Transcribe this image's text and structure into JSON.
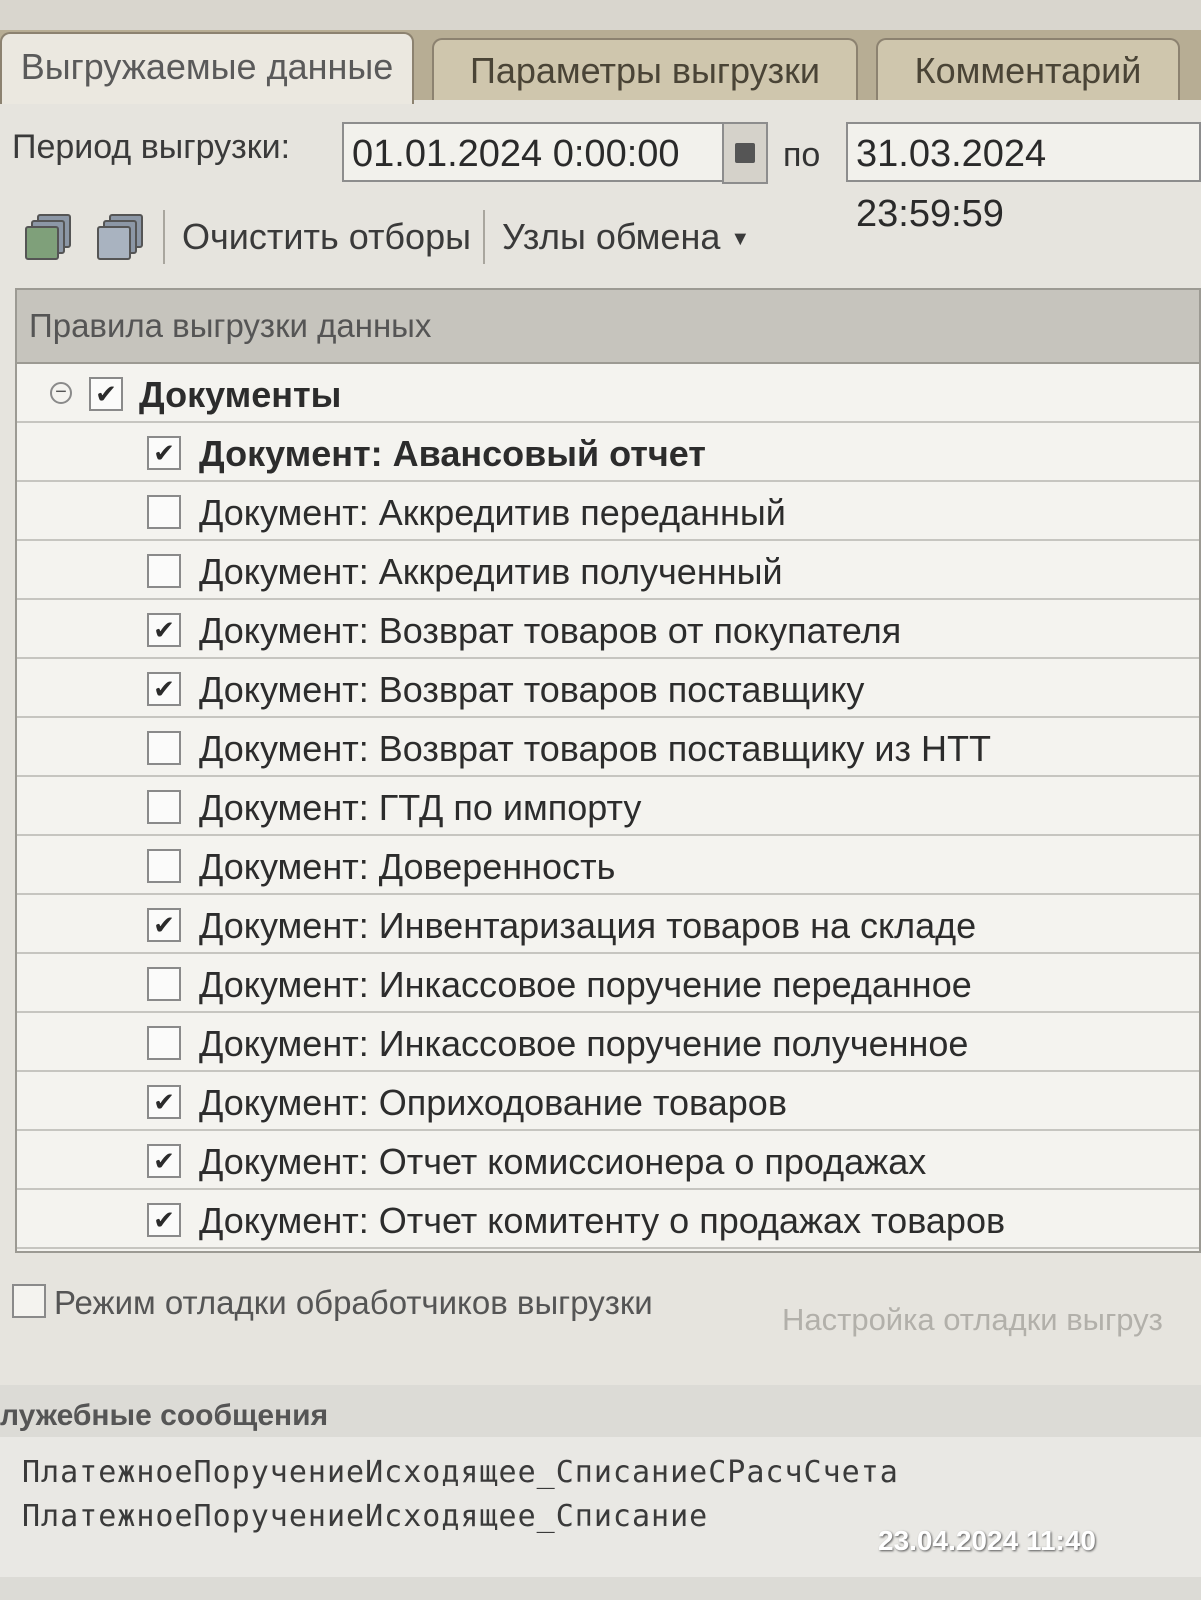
{
  "tabs": [
    {
      "label": "Выгружаемые данные",
      "active": true
    },
    {
      "label": "Параметры выгрузки",
      "active": false
    },
    {
      "label": "Комментарий",
      "active": false
    }
  ],
  "period": {
    "label": "Период выгрузки:",
    "from": "01.01.2024  0:00:00",
    "to_label": "по",
    "to": "31.03.2024 23:59:59"
  },
  "toolbar": {
    "select_all_icon": "check-all-icon",
    "unselect_all_icon": "uncheck-all-icon",
    "clear_filters": "Очистить отборы",
    "exchange_nodes": "Узлы обмена",
    "dropdown_caret": "▼"
  },
  "tree": {
    "header": "Правила выгрузки данных",
    "group": {
      "label": "Документы",
      "checked": true,
      "collapse_symbol": "−"
    },
    "items": [
      {
        "label": "Документ: Авансовый отчет",
        "checked": true,
        "bold": true
      },
      {
        "label": "Документ: Аккредитив переданный",
        "checked": false
      },
      {
        "label": "Документ: Аккредитив полученный",
        "checked": false
      },
      {
        "label": "Документ: Возврат товаров от покупателя",
        "checked": true
      },
      {
        "label": "Документ: Возврат товаров поставщику",
        "checked": true
      },
      {
        "label": "Документ: Возврат товаров поставщику из НТТ",
        "checked": false
      },
      {
        "label": "Документ: ГТД по импорту",
        "checked": false
      },
      {
        "label": "Документ: Доверенность",
        "checked": false
      },
      {
        "label": "Документ: Инвентаризация товаров на складе",
        "checked": true
      },
      {
        "label": "Документ: Инкассовое поручение переданное",
        "checked": false
      },
      {
        "label": "Документ: Инкассовое поручение полученное",
        "checked": false
      },
      {
        "label": "Документ: Оприходование товаров",
        "checked": true
      },
      {
        "label": "Документ: Отчет комиссионера о продажах",
        "checked": true
      },
      {
        "label": "Документ: Отчет комитенту о продажах товаров",
        "checked": true
      }
    ]
  },
  "debug": {
    "label": "Режим отладки обработчиков выгрузки",
    "settings_link": "Настройка отладки выгруз"
  },
  "messages": {
    "title": "лужебные сообщения",
    "lines": [
      "ПлатежноеПоручениеИсходящее_СписаниеСРасчСчета",
      "ПлатежноеПоручениеИсходящее_Списание"
    ]
  },
  "photo_timestamp": "23.04.2024 11:40",
  "check_mark": "✔"
}
